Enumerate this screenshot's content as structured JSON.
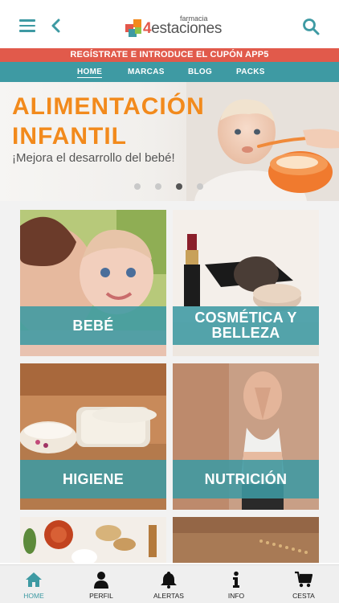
{
  "header": {
    "logo_small": "farmacia",
    "logo_number": "4",
    "logo_main": "estaciones",
    "menu_icon": "hamburger-menu-icon",
    "back_icon": "chevron-left-icon",
    "search_icon": "search-icon"
  },
  "promo": {
    "text": "REGÍSTRATE E INTRODUCE EL CUPÓN APP5"
  },
  "nav": {
    "tabs": [
      {
        "label": "HOME",
        "active": true
      },
      {
        "label": "MARCAS",
        "active": false
      },
      {
        "label": "BLOG",
        "active": false
      },
      {
        "label": "PACKS",
        "active": false
      }
    ]
  },
  "hero": {
    "title_line1": "ALIMENTACIÓN",
    "title_line2": "INFANTIL",
    "subtitle": "¡Mejora el desarrollo del bebé!",
    "slide_count": 4,
    "active_slide": 3
  },
  "categories": [
    {
      "label": "BEBÉ"
    },
    {
      "label": "COSMÉTICA Y BELLEZA"
    },
    {
      "label": "HIGIENE"
    },
    {
      "label": "NUTRICIÓN"
    }
  ],
  "tabbar": {
    "items": [
      {
        "label": "HOME",
        "icon": "home-icon",
        "active": true
      },
      {
        "label": "PERFIL",
        "icon": "user-icon",
        "active": false
      },
      {
        "label": "ALERTAS",
        "icon": "bell-icon",
        "active": false
      },
      {
        "label": "INFO",
        "icon": "info-icon",
        "active": false
      },
      {
        "label": "CESTA",
        "icon": "cart-icon",
        "active": false
      }
    ]
  },
  "colors": {
    "accent": "#3e9aa3",
    "promo": "#e15a4b",
    "hero_title": "#f28a1c"
  }
}
